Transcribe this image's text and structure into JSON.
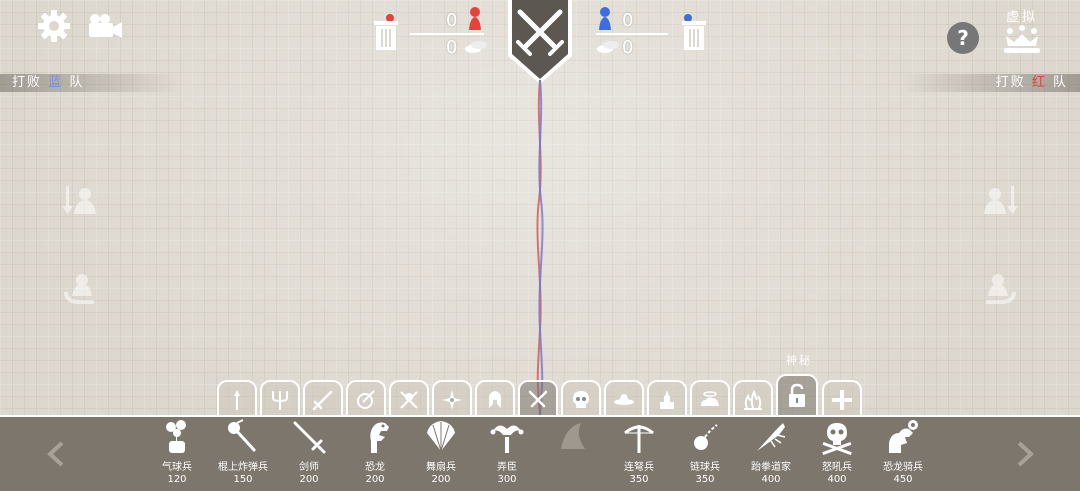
{
  "topbar": {
    "settings_icon": "gear-icon",
    "camera_icon": "camera-icon"
  },
  "banners": {
    "left": {
      "prefix": "打败",
      "team": "蓝",
      "suffix": "队"
    },
    "right": {
      "prefix": "打败",
      "team": "红",
      "suffix": "队"
    }
  },
  "score": {
    "red_units": "0",
    "red_cost": "0",
    "blue_units": "0",
    "blue_cost": "0"
  },
  "right_top": {
    "help": "?",
    "sandbox_label": "虚拟"
  },
  "tabs": {
    "mystery_label": "神秘",
    "items": [
      "spear",
      "trident",
      "sword",
      "shield-sword",
      "axes",
      "shuriken",
      "spartan",
      "crossed-swords",
      "skull",
      "hat",
      "temple",
      "lamp",
      "fire",
      "lock",
      "plus"
    ]
  },
  "units": [
    {
      "name": "气球兵",
      "cost": "120"
    },
    {
      "name": "棍上炸弹兵",
      "cost": "150"
    },
    {
      "name": "剑师",
      "cost": "200"
    },
    {
      "name": "恐龙",
      "cost": "200"
    },
    {
      "name": "舞扇兵",
      "cost": "200"
    },
    {
      "name": "弄臣",
      "cost": "300"
    },
    {
      "name": "",
      "cost": ""
    },
    {
      "name": "连弩兵",
      "cost": "350"
    },
    {
      "name": "链球兵",
      "cost": "350"
    },
    {
      "name": "跆拳道家",
      "cost": "400"
    },
    {
      "name": "怒吼兵",
      "cost": "400"
    },
    {
      "name": "恐龙骑兵",
      "cost": "450"
    }
  ],
  "colors": {
    "red_team": "#e8403a",
    "blue_team": "#3c6ee0",
    "bar_bg": "#7c766d"
  }
}
